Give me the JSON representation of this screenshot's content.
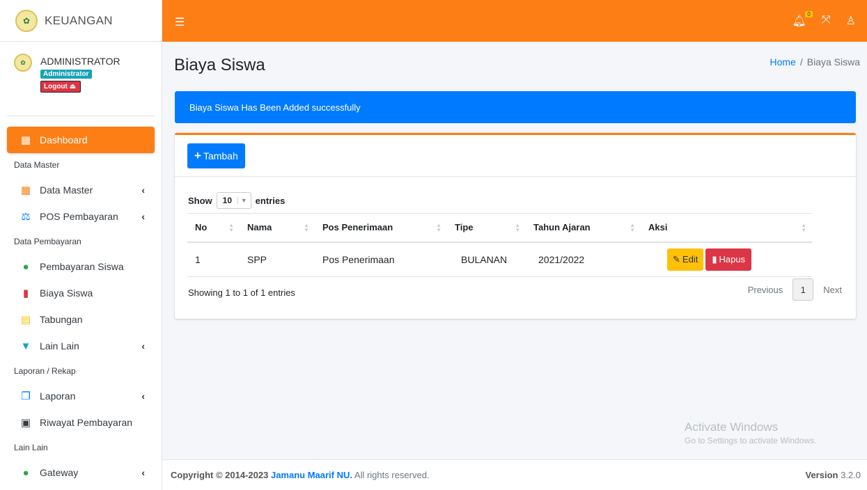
{
  "brand": {
    "name": "KEUANGAN",
    "logo_icon": "school-logo-icon"
  },
  "user": {
    "name": "ADMINISTRATOR",
    "role": "Administrator",
    "logout": "Logout ⏏"
  },
  "sidebar": {
    "dashboard": "Dashboard",
    "sections": {
      "data_master_header": "Data Master",
      "data_pembayaran_header": "Data Pembayaran",
      "laporan_header": "Laporan / Rekap",
      "lain_header": "Lain Lain"
    },
    "items": {
      "data_master": "Data Master",
      "pos_pembayaran": "POS Pembayaran",
      "pembayaran_siswa": "Pembayaran Siswa",
      "biaya_siswa": "Biaya Siswa",
      "tabungan": "Tabungan",
      "lain_lain": "Lain Lain",
      "laporan": "Laporan",
      "riwayat": "Riwayat Pembayaran",
      "gateway": "Gateway"
    }
  },
  "topbar": {
    "notif_count": "0"
  },
  "page": {
    "title": "Biaya Siswa",
    "breadcrumb": {
      "home": "Home",
      "sep": "/",
      "current": "Biaya Siswa"
    }
  },
  "alert": {
    "message": "Biaya Siswa Has Been Added successfully"
  },
  "card": {
    "add_button": "Tambah",
    "show_label": "Show",
    "entries_label": "entries",
    "page_length": "10",
    "columns": [
      "No",
      "Nama",
      "Pos Penerimaan",
      "Tipe",
      "Tahun Ajaran",
      "Aksi"
    ],
    "rows": [
      {
        "no": "1",
        "nama": "SPP",
        "pos": "Pos Penerimaan",
        "tipe": "BULANAN",
        "tahun": "2021/2022"
      }
    ],
    "edit_label": "Edit",
    "hapus_label": "Hapus",
    "info": "Showing 1 to 1 of 1 entries",
    "pager": {
      "prev": "Previous",
      "current": "1",
      "next": "Next"
    }
  },
  "watermark": {
    "title": "Activate Windows",
    "subtitle": "Go to Settings to activate Windows."
  },
  "footer": {
    "copyright": "Copyright © 2014-2023 ",
    "org": "Jamanu Maarif NU.",
    "rights": " All rights reserved.",
    "version_label": "Version",
    "version": " 3.2.0"
  },
  "colors": {
    "primary": "#fd7e14",
    "info": "#007bff",
    "warning": "#ffc107",
    "danger": "#dc3545"
  }
}
